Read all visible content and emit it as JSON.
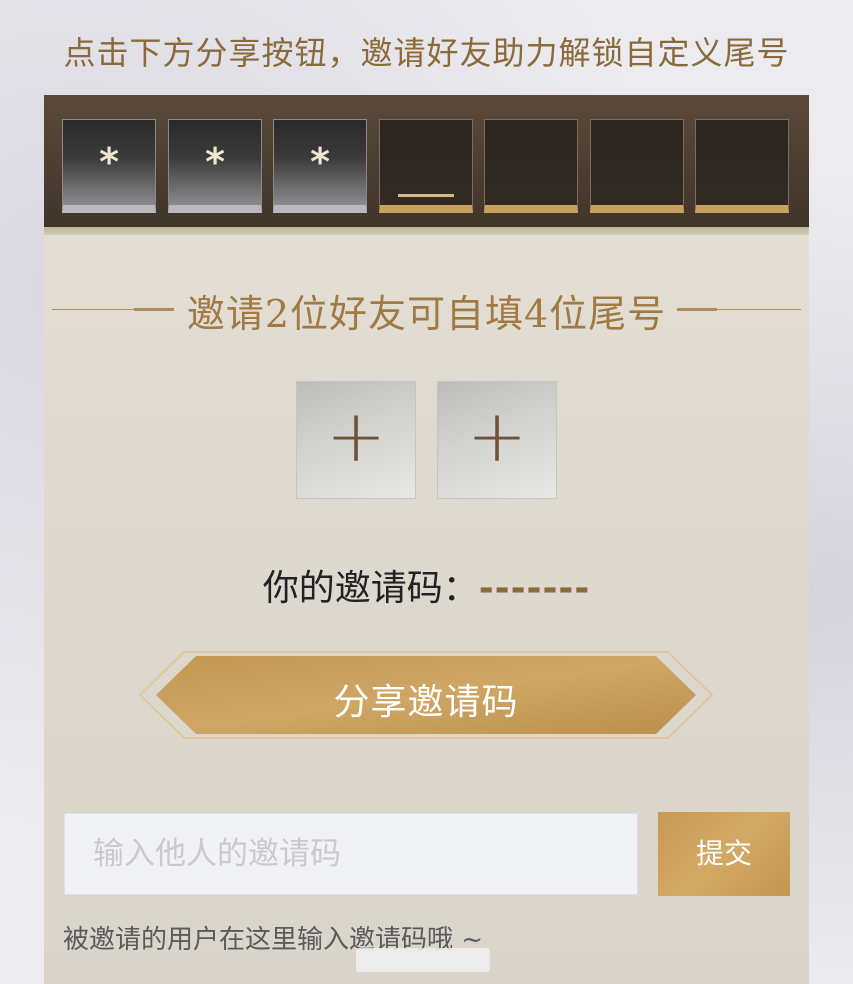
{
  "headline": "点击下方分享按钮，邀请好友助力解锁自定义尾号",
  "slots": {
    "filled_char": "*",
    "count_filled": 3,
    "count_empty": 4,
    "active_slot_index": 3
  },
  "section_title": "邀请2位好友可自填4位尾号",
  "invite_code": {
    "label": "你的邀请码：",
    "value": "-------"
  },
  "add_slot_symbol": "+",
  "share_button": {
    "label": "分享邀请码"
  },
  "code_input": {
    "placeholder": "输入他人的邀请码",
    "value": ""
  },
  "submit_button": {
    "label": "提交"
  },
  "hint": "被邀请的用户在这里输入邀请码哦 ~",
  "colors": {
    "accent_gold": "#c79a55",
    "title_brown": "#a07a42",
    "slot_gold_edge": "#c9a15e"
  }
}
